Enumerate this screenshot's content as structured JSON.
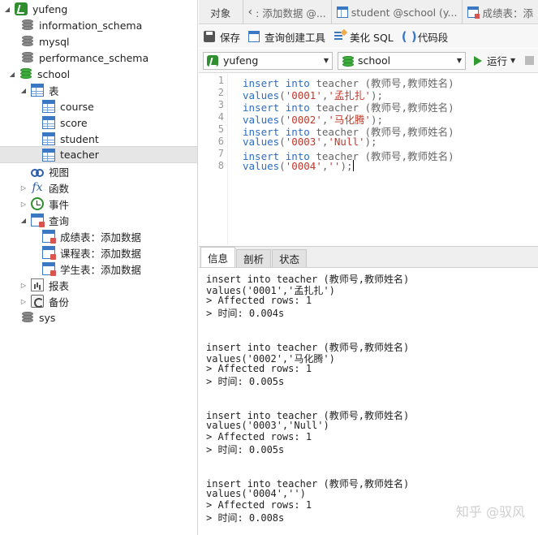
{
  "tree": {
    "connection": "yufeng",
    "databases": [
      "information_schema",
      "mysql",
      "performance_schema"
    ],
    "active_db": "school",
    "tables_group": "表",
    "tables": [
      "course",
      "score",
      "student",
      "teacher"
    ],
    "selected_table": "teacher",
    "views": "视图",
    "functions": "函数",
    "events": "事件",
    "queries_group": "查询",
    "queries": [
      "成绩表：添加数据",
      "课程表：添加数据",
      "学生表：添加数据"
    ],
    "reports": "报表",
    "backup": "备份",
    "sys_db": "sys"
  },
  "tabs": {
    "objects": "对象",
    "tab1": ": 添加数据 @...",
    "tab2": "student @school (y...",
    "tab3": "成绩表：添"
  },
  "toolbar": {
    "save": "保存",
    "query_builder": "查询创建工具",
    "beautify": "美化 SQL",
    "snippet": "代码段"
  },
  "selectors": {
    "connection": "yufeng",
    "database": "school",
    "run": "运行"
  },
  "editor": {
    "line_numbers": [
      "1",
      "2",
      "3",
      "4",
      "5",
      "6",
      "7",
      "8"
    ],
    "lines": [
      {
        "kw1": "insert",
        "kw2": "into",
        "rest": " teacher (教师号,教师姓名)"
      },
      {
        "kw1": "values",
        "open": "(",
        "s1": "'0001'",
        "mid": ",",
        "s2": "'孟扎扎'",
        "close": ");"
      },
      {
        "kw1": "insert",
        "kw2": "into",
        "rest": " teacher (教师号,教师姓名)"
      },
      {
        "kw1": "values",
        "open": "(",
        "s1": "'0002'",
        "mid": ",",
        "s2": "'马化腾'",
        "close": ");"
      },
      {
        "kw1": "insert",
        "kw2": "into",
        "rest": " teacher (教师号,教师姓名)"
      },
      {
        "kw1": "values",
        "open": "(",
        "s1": "'0003'",
        "mid": ",",
        "s2": "'Null'",
        "close": ");"
      },
      {
        "kw1": "insert",
        "kw2": "into",
        "rest": " teacher (教师号,教师姓名)"
      },
      {
        "kw1": "values",
        "open": "(",
        "s1": "'0004'",
        "mid": ",",
        "s2": "''",
        "close": ");"
      }
    ]
  },
  "results": {
    "tabs": [
      "信息",
      "剖析",
      "状态"
    ],
    "active_tab": "信息",
    "blocks": [
      [
        "insert into teacher (教师号,教师姓名)",
        "values('0001','孟扎扎')",
        "> Affected rows: 1",
        "> 时间: 0.004s"
      ],
      [
        "insert into teacher (教师号,教师姓名)",
        "values('0002','马化腾')",
        "> Affected rows: 1",
        "> 时间: 0.005s"
      ],
      [
        "insert into teacher (教师号,教师姓名)",
        "values('0003','Null')",
        "> Affected rows: 1",
        "> 时间: 0.005s"
      ],
      [
        "insert into teacher (教师号,教师姓名)",
        "values('0004','')",
        "> Affected rows: 1",
        "> 时间: 0.008s"
      ]
    ]
  },
  "watermark": "知乎 @驭风",
  "colors": {
    "keyword": "#2b6cc4",
    "string": "#c0392b",
    "connection_green": "#2f8f2f",
    "run_green": "#2f9b2f"
  }
}
